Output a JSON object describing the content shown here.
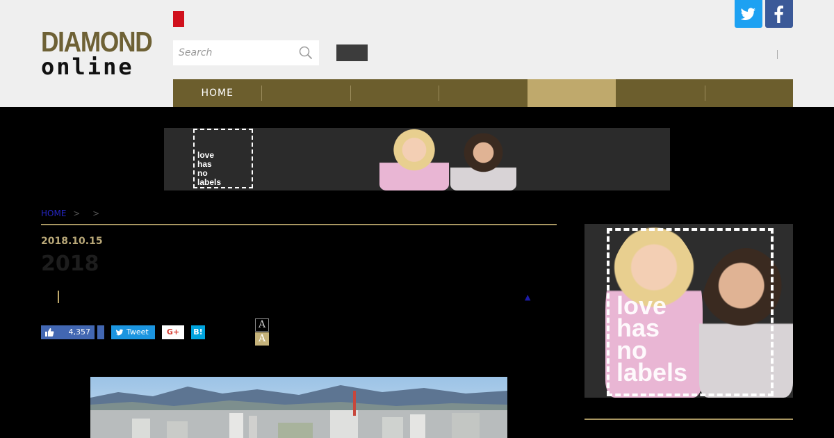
{
  "header": {
    "logo_top": "DIAMOND",
    "logo_bottom": "online",
    "search_placeholder": "Search",
    "social": {
      "twitter_icon": "twitter-icon",
      "facebook_icon": "facebook-icon"
    }
  },
  "nav": {
    "items": [
      {
        "label": "HOME",
        "active": false
      },
      {
        "label": "",
        "active": false
      },
      {
        "label": "",
        "active": false
      },
      {
        "label": "",
        "active": false
      },
      {
        "label": "",
        "active": true
      },
      {
        "label": "",
        "active": false
      },
      {
        "label": "",
        "active": false
      }
    ]
  },
  "banner": {
    "ad_text": "love\nhas\nno\nlabels"
  },
  "article": {
    "breadcrumb_home": "HOME",
    "breadcrumb_sep1": ">",
    "breadcrumb_sep2": ">",
    "date": "2018.10.15",
    "title": "2018",
    "triangle": "▲"
  },
  "share": {
    "like_count": "4,357",
    "tweet_label": "Tweet",
    "gplus_label": "G+",
    "hatena_label": "B!",
    "font_small": "A",
    "font_large": "A"
  },
  "sidebar": {
    "ad_text": "love\nhas\nno\nlabels"
  },
  "colors": {
    "header_bg": "#efefef",
    "nav_bg": "#6c5e2d",
    "nav_active": "#bfa96c",
    "logo_gold": "#6e6135",
    "accent_gold": "#a99762",
    "twitter": "#1da1f2",
    "facebook": "#3b5998"
  }
}
